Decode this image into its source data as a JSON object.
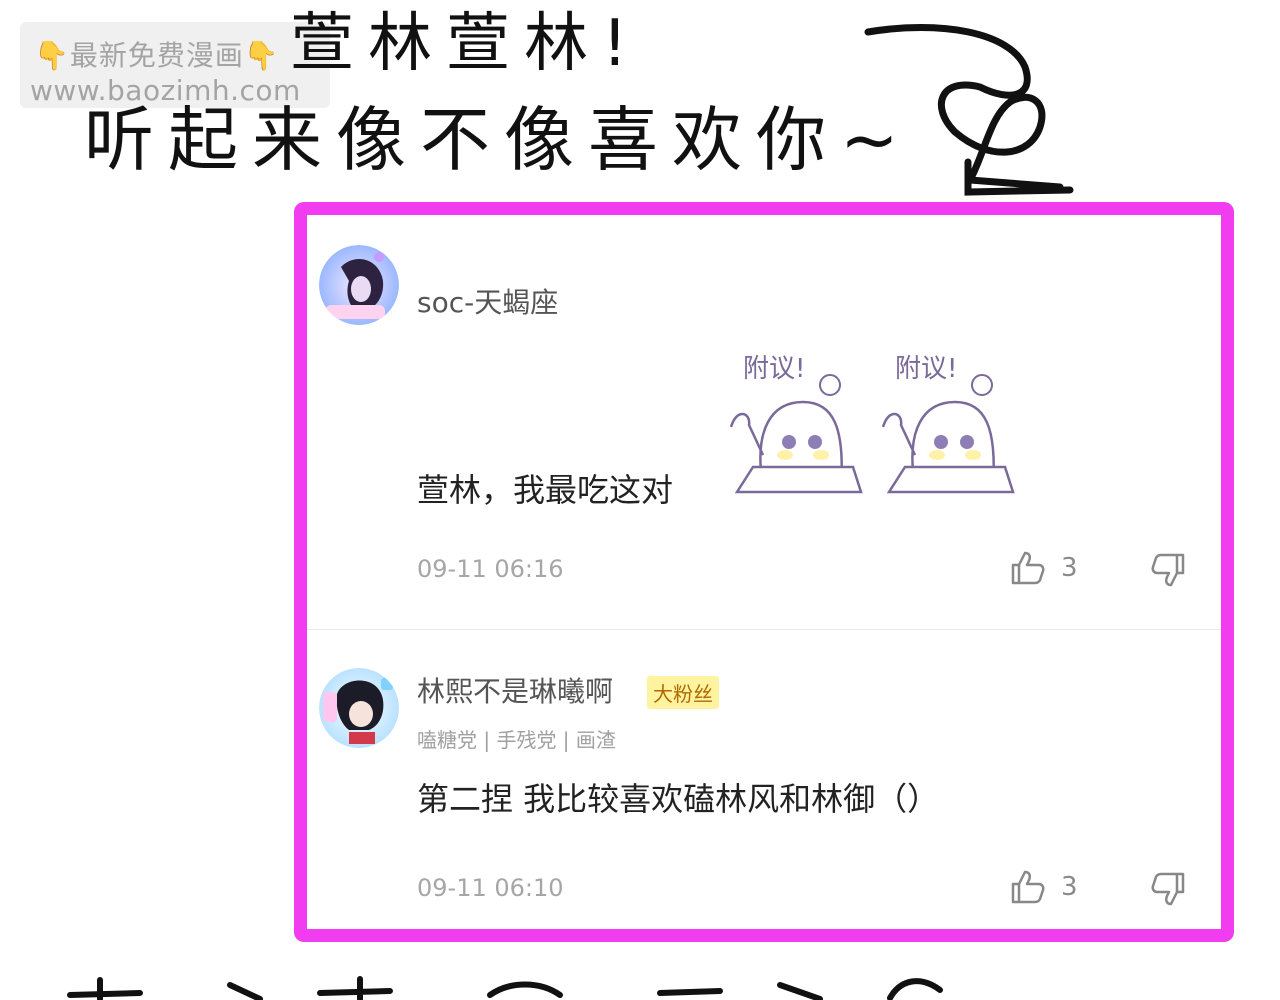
{
  "watermark": {
    "line1": "👇最新免费漫画👇",
    "line2": "www.baozimh.com"
  },
  "handwriting": {
    "top_line1": "萱林萱林!",
    "top_line2": "听起来像不像喜欢你~"
  },
  "comments": [
    {
      "username": "soc-天蝎座",
      "text": "萱林，我最吃这对",
      "sticker_caption": "附议!",
      "timestamp": "09-11 06:16",
      "likes": "3"
    },
    {
      "username": "林熙不是琳曦啊",
      "badge": "大粉丝",
      "tags": "嗑糖党 | 手残党 | 画渣",
      "text": "第二捏 我比较喜欢磕林风和林御（）",
      "timestamp": "09-11 06:10",
      "likes": "3"
    }
  ],
  "colors": {
    "frame_border": "#f23cf0",
    "badge_bg": "#fff3a0",
    "muted_text": "#a6a6a6"
  },
  "icons": [
    "thumbs-up-icon",
    "thumbs-down-icon",
    "avatar",
    "sticker"
  ]
}
